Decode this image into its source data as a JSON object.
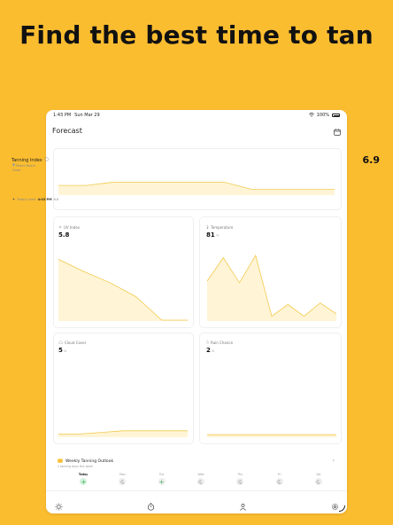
{
  "headline": "Find the best time to tan",
  "status_bar": {
    "time": "1:43 PM",
    "date": "Sun Mar 29",
    "battery": "100%"
  },
  "nav": {
    "title": "Forecast"
  },
  "tanning_index": {
    "title": "Tanning Index",
    "location": "Miami Beach",
    "condition": "Good",
    "value": "6.9",
    "best_label": "Today's best",
    "best_time": "4:43 PM",
    "best_value": "6.8",
    "levels": [
      0.45,
      0.45,
      0.62,
      0.62,
      0.62,
      0.62,
      0.62,
      0.25,
      0.25,
      0.25,
      0.25
    ]
  },
  "cards": {
    "uv": {
      "label": "UV Index",
      "value": "5.8",
      "unit": "",
      "levels": [
        0.78,
        0.62,
        0.48,
        0.3,
        0.0,
        0.0
      ]
    },
    "temperature": {
      "label": "Temperature",
      "value": "81",
      "unit": "°F",
      "levels": [
        0.5,
        0.8,
        0.48,
        0.83,
        0.05,
        0.2,
        0.05,
        0.22,
        0.08
      ]
    },
    "cloud": {
      "label": "Cloud Cover",
      "value": "5",
      "unit": "%",
      "levels": [
        0.03,
        0.03,
        0.05,
        0.07,
        0.07,
        0.07,
        0.07
      ]
    },
    "rain": {
      "label": "Rain Chance",
      "value": "2",
      "unit": "%",
      "levels": [
        0.02,
        0.02,
        0.02,
        0.02,
        0.02
      ]
    }
  },
  "weekly": {
    "title": "Weekly Tanning Outlook",
    "subtitle": "2 tanning days this week",
    "days": [
      {
        "label": "Today",
        "icon": "sun-icon"
      },
      {
        "label": "Mon",
        "icon": "moon-icon"
      },
      {
        "label": "Tue",
        "icon": "sun-icon"
      },
      {
        "label": "Wed",
        "icon": "moon-icon"
      },
      {
        "label": "Thu",
        "icon": "moon-icon"
      },
      {
        "label": "Fri",
        "icon": "moon-icon"
      },
      {
        "label": "Sat",
        "icon": "moon-icon"
      }
    ]
  },
  "colors": {
    "background": "#FBBD30",
    "chart_line": "#F2C94C",
    "chart_fill": "#FFF5D6",
    "good": "#2FA84F"
  },
  "tabs": [
    "sun-icon",
    "timer-icon",
    "person-icon",
    "gear-icon"
  ]
}
